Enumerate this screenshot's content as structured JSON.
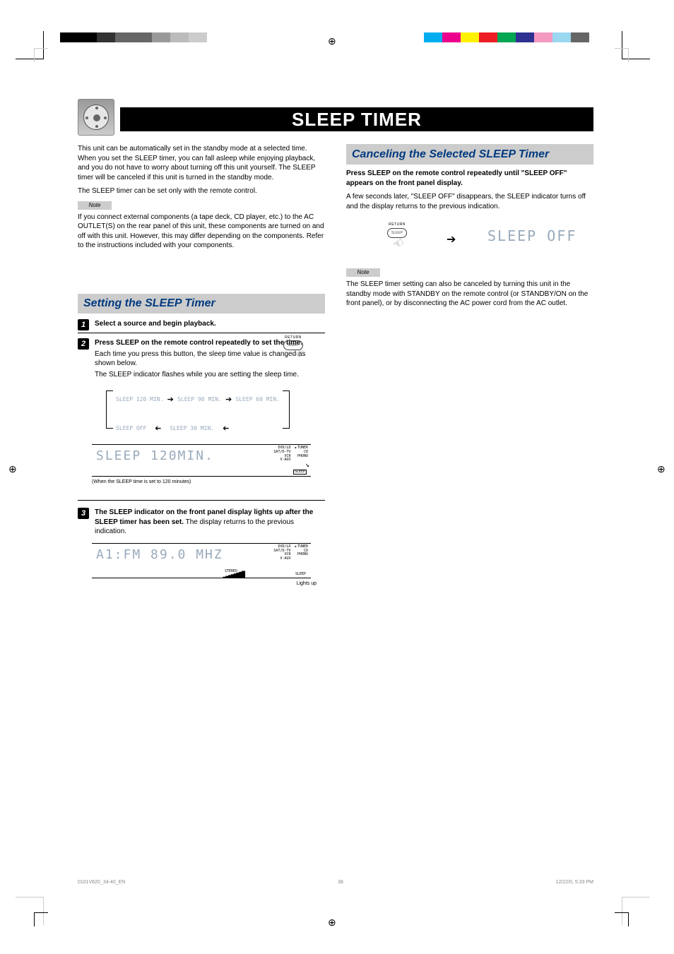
{
  "title": "SLEEP TIMER",
  "intro": {
    "p1": "This unit can be automatically set in the standby mode at a selected time. When you set the SLEEP timer, you can fall asleep while enjoying playback, and you do not have to worry about turning off this unit yourself. The SLEEP timer will be canceled if this unit is turned in the standby mode.",
    "p2": "The SLEEP timer can be set only with the remote control.",
    "note_label": "Note",
    "note_body": "If you connect external components (a tape deck, CD player, etc.) to the AC OUTLET(S) on the rear panel of this unit, these components are turned on and off with this unit. However, this may differ depending on the components. Refer to the instructions included with your components."
  },
  "left": {
    "section_title": "Setting the SLEEP Timer",
    "step1": {
      "bold": "Select a source and begin playback.",
      "rest": ""
    },
    "step2": {
      "bold": "Press SLEEP on the remote control repeatedly to set the time.",
      "p1": "Each time you press this button, the sleep time value is changed as shown below.",
      "p2": "The SLEEP indicator flashes while you are setting the sleep time.",
      "btn_top_label": "RETURN",
      "btn_inner_label": "SLEEP",
      "cycle": {
        "a": "SLEEP 120 MIN.",
        "b": "SLEEP 90 MIN.",
        "c": "SLEEP 60 MIN.",
        "d": "SLEEP OFF",
        "e": "SLEEP 30 MIN."
      },
      "lcd": {
        "main": "SLEEP 120MIN.",
        "src_dvd": "DVD/LD",
        "src_sat": "SAT/D-TV",
        "src_vcr": "VCR",
        "src_vaux": "V-AUX",
        "src_tuner": "TUNER",
        "src_cd": "CD",
        "src_phono": "PHONO",
        "sleep": "SLEEP",
        "caption": "(When the SLEEP time is set to 120 minutes)"
      }
    },
    "step3": {
      "bold": "The SLEEP indicator on the front panel display lights up after the SLEEP timer has been set.",
      "rest": "The display returns to the previous indication.",
      "lcd": {
        "main": "A1:FM 89.0 MHZ",
        "stereo": "STEREO",
        "signal": "▁▂▃▄▅▆▇█",
        "src_dvd": "DVD/LD",
        "src_sat": "SAT/D-TV",
        "src_vcr": "VCR",
        "src_vaux": "V-AUX",
        "src_tuner": "TUNER",
        "src_cd": "CD",
        "src_phono": "PHONO",
        "sleep": "SLEEP",
        "caption": "Lights up"
      }
    }
  },
  "right": {
    "section_title": "Canceling the Selected SLEEP Timer",
    "p1_bold": "Press SLEEP on the remote control repeatedly until \"SLEEP OFF\" appears on the front panel display.",
    "p2": "A few seconds later, \"SLEEP OFF\" disappears, the SLEEP indicator turns off and the display returns to the previous indication.",
    "btn_top_label": "RETURN",
    "btn_inner_label": "SLEEP",
    "off_text": "SLEEP OFF",
    "note_label": "Note",
    "note_body": "The SLEEP timer setting can also be canceled by turning this unit in the standby mode with STANDBY on the remote control (or STANDBY/ON on the front panel), or by disconnecting the AC power cord from the AC outlet."
  },
  "footer": {
    "left": "0101V620_34-40_EN",
    "page": "38",
    "right": "12/22/0, 5:33 PM"
  }
}
